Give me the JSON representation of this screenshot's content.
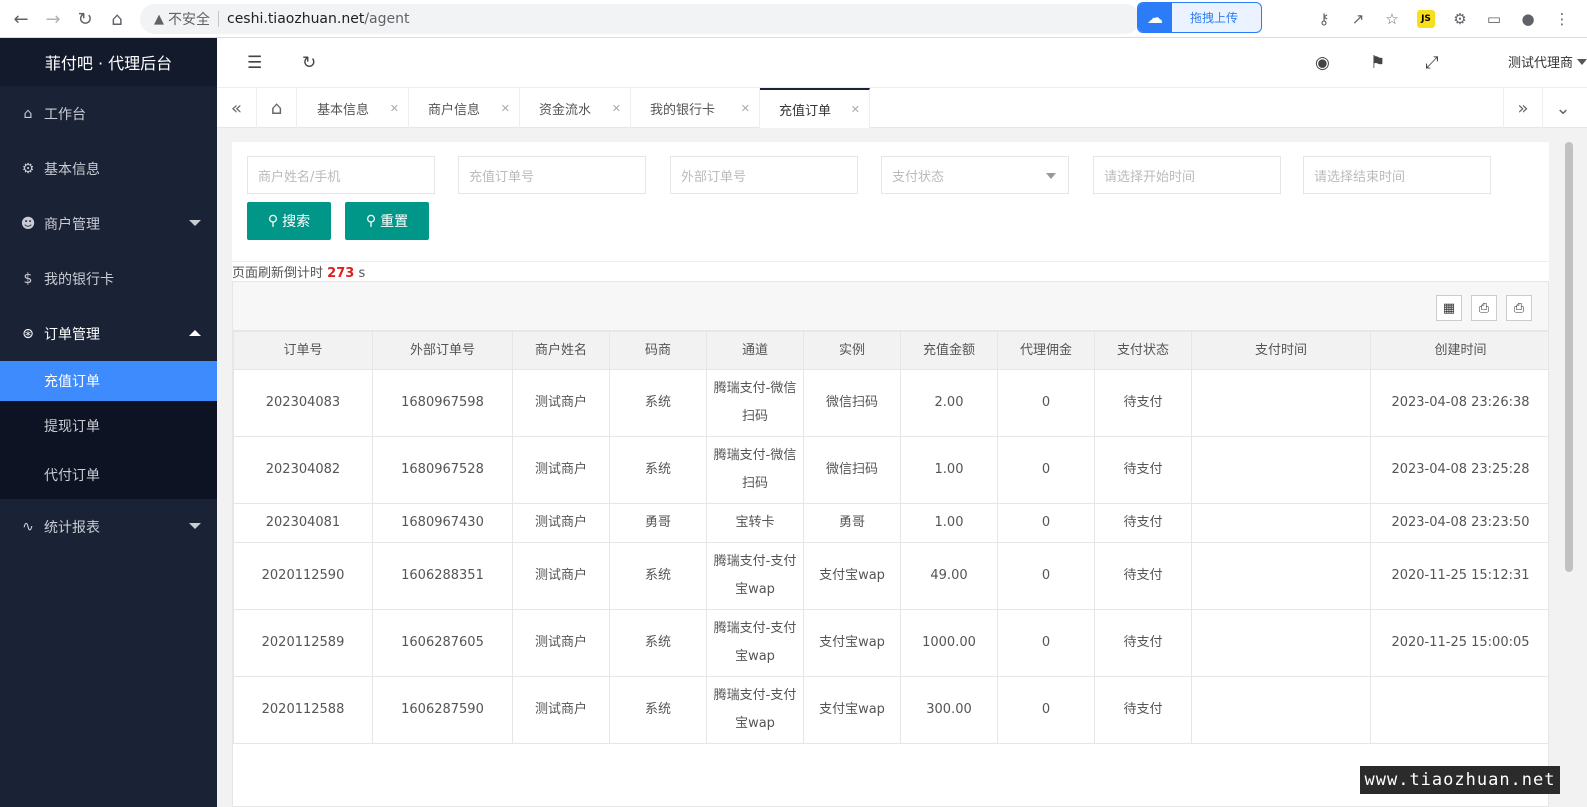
{
  "browser": {
    "insecure": "不安全",
    "url_host": "ceshi.tiaozhuan.net",
    "url_path": "/agent",
    "upload_label": "拖拽上传"
  },
  "sidebar": {
    "logo": "菲付吧 · 代理后台",
    "items": [
      {
        "label": "工作台",
        "icon": "home-icon"
      },
      {
        "label": "基本信息",
        "icon": "gear-icon"
      },
      {
        "label": "商户管理",
        "icon": "user-icon"
      },
      {
        "label": "我的银行卡",
        "icon": "dollar-icon"
      },
      {
        "label": "订单管理",
        "icon": "cart-icon"
      },
      {
        "label": "统计报表",
        "icon": "pulse-icon"
      }
    ],
    "sub_items": [
      "充值订单",
      "提现订单",
      "代付订单"
    ]
  },
  "header": {
    "user": "测试代理商"
  },
  "tabs": [
    "基本信息",
    "商户信息",
    "资金流水",
    "我的银行卡",
    "充值订单"
  ],
  "search": {
    "merchant_placeholder": "商户姓名/手机",
    "order_placeholder": "充值订单号",
    "external_placeholder": "外部订单号",
    "status_placeholder": "支付状态",
    "start_placeholder": "请选择开始时间",
    "end_placeholder": "请选择结束时间",
    "search_label": "搜索",
    "reset_label": "重置"
  },
  "countdown": {
    "prefix": "页面刷新倒计时",
    "value": "273",
    "unit": "s"
  },
  "table": {
    "columns": [
      "订单号",
      "外部订单号",
      "商户姓名",
      "码商",
      "通道",
      "实例",
      "充值金额",
      "代理佣金",
      "支付状态",
      "支付时间",
      "创建时间"
    ],
    "rows": [
      [
        "202304083",
        "1680967598",
        "测试商户",
        "系统",
        "腾瑞支付-微信扫码",
        "微信扫码",
        "2.00",
        "0",
        "待支付",
        "",
        "2023-04-08 23:26:38"
      ],
      [
        "202304082",
        "1680967528",
        "测试商户",
        "系统",
        "腾瑞支付-微信扫码",
        "微信扫码",
        "1.00",
        "0",
        "待支付",
        "",
        "2023-04-08 23:25:28"
      ],
      [
        "202304081",
        "1680967430",
        "测试商户",
        "勇哥",
        "宝转卡",
        "勇哥",
        "1.00",
        "0",
        "待支付",
        "",
        "2023-04-08 23:23:50"
      ],
      [
        "2020112590",
        "1606288351",
        "测试商户",
        "系统",
        "腾瑞支付-支付宝wap",
        "支付宝wap",
        "49.00",
        "0",
        "待支付",
        "",
        "2020-11-25 15:12:31"
      ],
      [
        "2020112589",
        "1606287605",
        "测试商户",
        "系统",
        "腾瑞支付-支付宝wap",
        "支付宝wap",
        "1000.00",
        "0",
        "待支付",
        "",
        "2020-11-25 15:00:05"
      ],
      [
        "2020112588",
        "1606287590",
        "测试商户",
        "系统",
        "腾瑞支付-支付宝wap",
        "支付宝wap",
        "300.00",
        "0",
        "待支付",
        "",
        ""
      ]
    ]
  },
  "watermark": "www.tiaozhuan.net"
}
